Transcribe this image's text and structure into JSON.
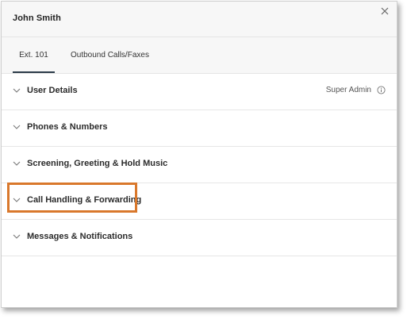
{
  "header": {
    "title": "John Smith"
  },
  "tabs": [
    {
      "label": "Ext. 101",
      "active": true
    },
    {
      "label": "Outbound Calls/Faxes",
      "active": false
    }
  ],
  "sections": [
    {
      "label": "User Details",
      "right_text": "Super Admin"
    },
    {
      "label": "Phones & Numbers"
    },
    {
      "label": "Screening, Greeting & Hold Music"
    },
    {
      "label": "Call Handling & Forwarding",
      "highlighted": true
    },
    {
      "label": "Messages & Notifications"
    }
  ],
  "icons": {
    "close": "close-icon",
    "chevron": "chevron-down-icon",
    "info": "info-icon"
  },
  "colors": {
    "highlight": "#d9782c",
    "tab_underline": "#2a3a48"
  }
}
